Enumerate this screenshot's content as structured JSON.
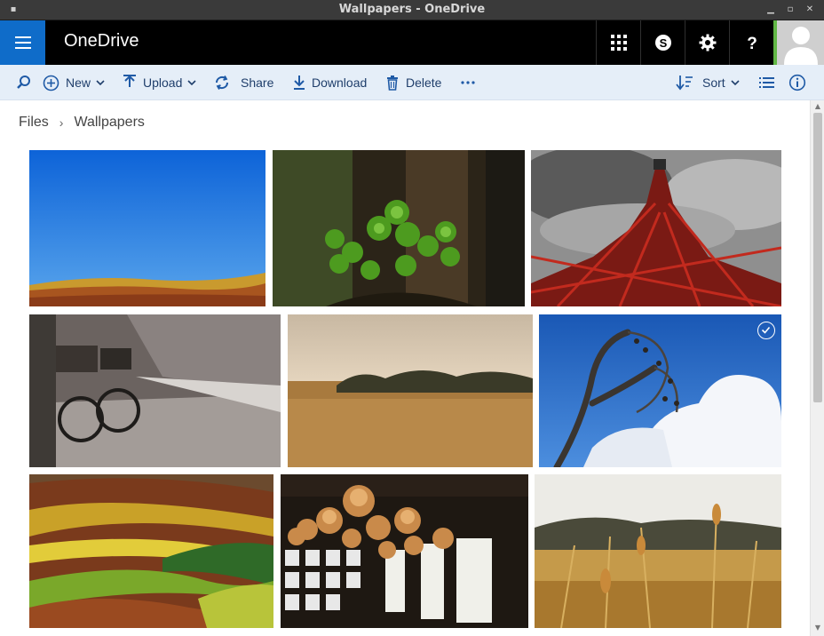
{
  "window": {
    "title": "Wallpapers - OneDrive"
  },
  "app": {
    "brand": "OneDrive"
  },
  "header_buttons": [
    {
      "icon": "app-launcher-icon"
    },
    {
      "icon": "skype-icon"
    },
    {
      "icon": "gear-icon"
    },
    {
      "icon": "help-icon"
    }
  ],
  "toolbar": {
    "new_label": "New",
    "upload_label": "Upload",
    "share_label": "Share",
    "download_label": "Download",
    "delete_label": "Delete",
    "sort_label": "Sort"
  },
  "breadcrumb": {
    "root": "Files",
    "current": "Wallpapers"
  },
  "colors": {
    "accent": "#0f6cc9",
    "toolbar_bg": "#e5eef8",
    "toolbar_text": "#1f3e6b",
    "presence": "#62b846"
  },
  "photos": [
    {
      "subject": "blue-sky-hills",
      "selected": false
    },
    {
      "subject": "clover-plant",
      "selected": false
    },
    {
      "subject": "red-tower",
      "selected": false
    },
    {
      "subject": "bicycles-street",
      "selected": false
    },
    {
      "subject": "golden-field",
      "selected": false
    },
    {
      "subject": "bare-tree-sky",
      "selected": true
    },
    {
      "subject": "terraced-fields",
      "selected": false
    },
    {
      "subject": "paper-lanterns",
      "selected": false
    },
    {
      "subject": "wheat-stalks",
      "selected": false
    }
  ]
}
